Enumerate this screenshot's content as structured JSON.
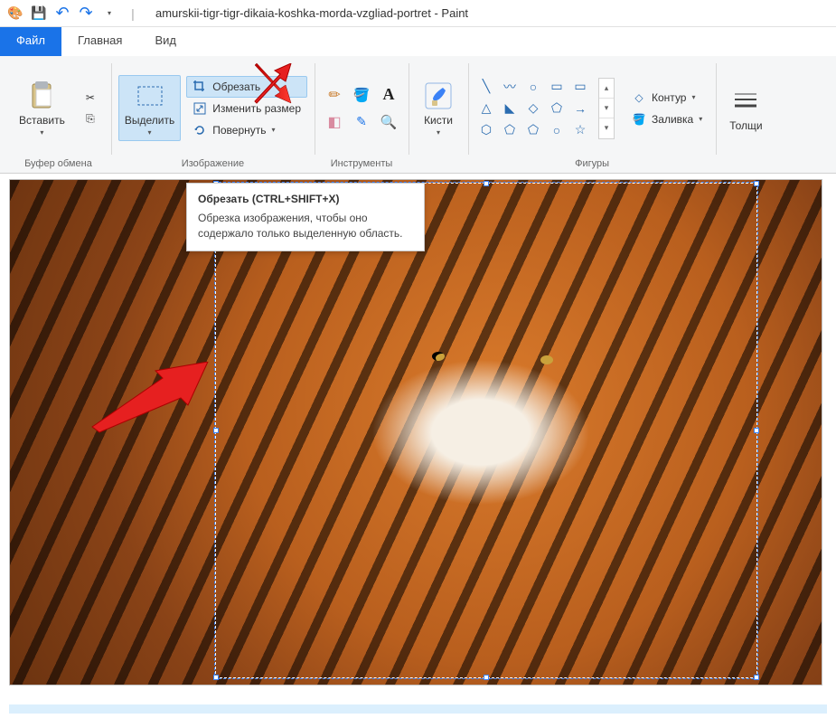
{
  "title": "amurskii-tigr-tigr-dikaia-koshka-morda-vzgliad-portret - Paint",
  "tabs": {
    "file": "Файл",
    "home": "Главная",
    "view": "Вид"
  },
  "clipboard": {
    "paste": "Вставить",
    "group": "Буфер обмена"
  },
  "image": {
    "select": "Выделить",
    "crop": "Обрезать",
    "resize": "Изменить размер",
    "rotate": "Повернуть",
    "group": "Изображение"
  },
  "tools": {
    "group": "Инструменты"
  },
  "brushes": {
    "label": "Кисти"
  },
  "shapes": {
    "group": "Фигуры",
    "outline": "Контур",
    "fill": "Заливка"
  },
  "size": {
    "label": "Толщи"
  },
  "tooltip": {
    "title": "Обрезать (CTRL+SHIFT+X)",
    "body": "Обрезка изображения, чтобы оно содержало только выделенную область."
  },
  "icons": {
    "save": "💾",
    "undo": "↶",
    "redo": "↷",
    "cut": "✂",
    "copy": "⎘",
    "crop": "✂",
    "resize": "⤢",
    "rotate": "⟳",
    "pencil": "✏",
    "fill": "🪣",
    "text": "A",
    "eraser": "▱",
    "picker": "◐",
    "magnifier": "🔍",
    "brush": "🖌",
    "outline": "◇",
    "paintcan": "🪣"
  },
  "shape_glyphs": [
    "╲",
    "〰",
    "○",
    "▭",
    "▭",
    "△",
    "◇",
    "⬠",
    "→",
    "⬡",
    "⬠",
    "⬠",
    "○",
    "◇",
    "☆"
  ]
}
